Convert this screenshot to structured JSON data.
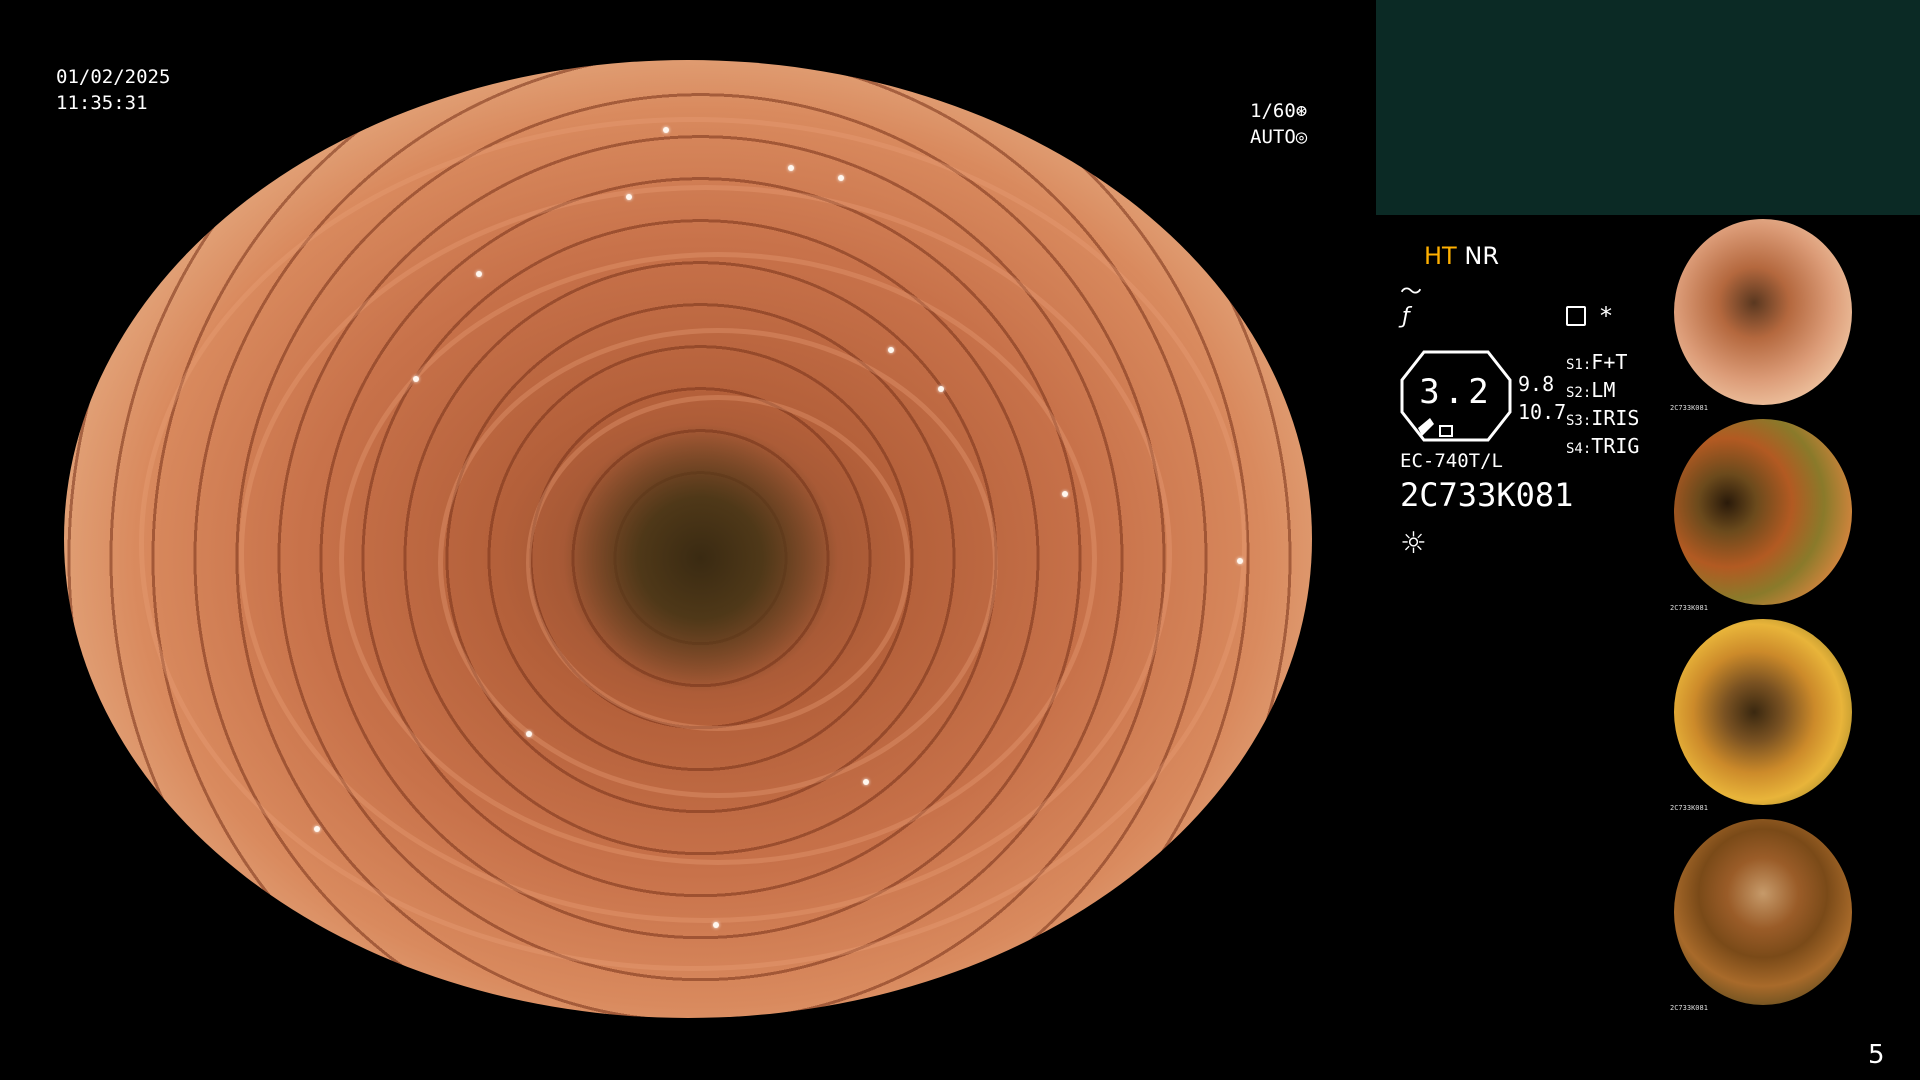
{
  "overlay": {
    "date": "01/02/2025",
    "time": "11:35:31",
    "shutter": "1/60",
    "iris_mode": "AUTO",
    "page_number": "5"
  },
  "status": {
    "ht": "HT",
    "nr": "NR",
    "enhancement_value": "3.2",
    "value_upper": "9.8",
    "value_lower": "10.7",
    "switches": [
      {
        "key": "S1",
        "value": "F+T"
      },
      {
        "key": "S2",
        "value": "LM"
      },
      {
        "key": "S3",
        "value": "IRIS"
      },
      {
        "key": "S4",
        "value": "TRIG"
      }
    ],
    "scope_model": "EC-740T/L",
    "scope_serial": "2C733K081"
  },
  "thumbnails": [
    {
      "label": "2C733K081"
    },
    {
      "label": "2C733K081"
    },
    {
      "label": "2C733K081"
    },
    {
      "label": "2C733K081"
    }
  ],
  "icons": {
    "shutter": "shutter-icon",
    "iris": "iris-icon",
    "light": "light-icon",
    "record": "record-icon",
    "asterisk": "asterisk-icon"
  },
  "colors": {
    "ht_color": "#ffb000",
    "top_panel": "#0b2a25",
    "text": "#ffffff"
  }
}
